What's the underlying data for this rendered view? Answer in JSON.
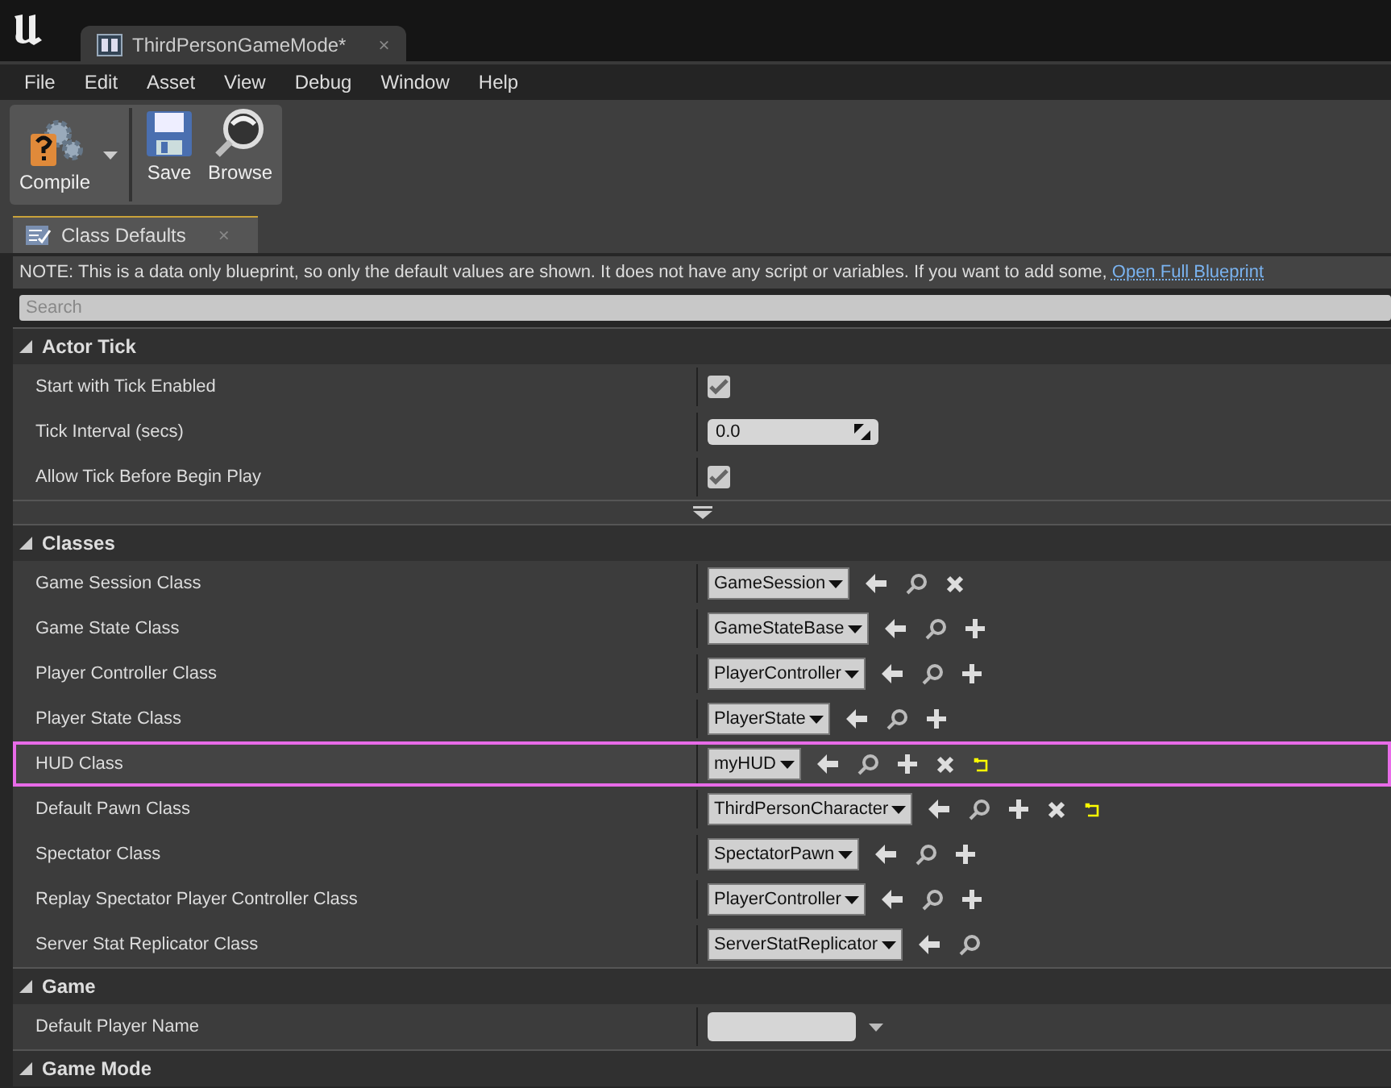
{
  "document_tab": {
    "title": "ThirdPersonGameMode*",
    "close": "×"
  },
  "menu": [
    "File",
    "Edit",
    "Asset",
    "View",
    "Debug",
    "Window",
    "Help"
  ],
  "toolbar": [
    {
      "kind": "compile",
      "label": "Compile"
    },
    {
      "kind": "save",
      "label": "Save"
    },
    {
      "kind": "browse",
      "label": "Browse"
    }
  ],
  "panel_tab": {
    "title": "Class Defaults",
    "close": "×"
  },
  "note": {
    "text": "NOTE: This is a data only blueprint, so only the default values are shown.  It does not have any script or variables.  If you want to add some,",
    "link": "Open Full Blueprint"
  },
  "search": {
    "placeholder": "Search"
  },
  "sections": [
    {
      "title": "Actor Tick",
      "expanded": true,
      "advanced": true,
      "rows": [
        {
          "label": "Start with Tick Enabled",
          "kind": "checkbox",
          "checked": true,
          "selected": false
        },
        {
          "label": "Tick Interval (secs)",
          "kind": "number",
          "value": "0.0",
          "selected": false
        },
        {
          "label": "Allow Tick Before Begin Play",
          "kind": "checkbox",
          "checked": true,
          "selected": false
        }
      ]
    },
    {
      "title": "Classes",
      "expanded": true,
      "rows": [
        {
          "label": "Game Session Class",
          "kind": "class",
          "value": "GameSession",
          "actions": [
            {
              "kind": "use"
            },
            {
              "kind": "browse"
            },
            {
              "kind": "clear"
            }
          ],
          "selected": false
        },
        {
          "label": "Game State Class",
          "kind": "class",
          "value": "GameStateBase",
          "actions": [
            {
              "kind": "use"
            },
            {
              "kind": "browse"
            },
            {
              "kind": "new"
            }
          ],
          "selected": false
        },
        {
          "label": "Player Controller Class",
          "kind": "class",
          "value": "PlayerController",
          "actions": [
            {
              "kind": "use"
            },
            {
              "kind": "browse"
            },
            {
              "kind": "new"
            }
          ],
          "selected": false
        },
        {
          "label": "Player State Class",
          "kind": "class",
          "value": "PlayerState",
          "actions": [
            {
              "kind": "use"
            },
            {
              "kind": "browse"
            },
            {
              "kind": "new"
            }
          ],
          "selected": false
        },
        {
          "label": "HUD Class",
          "kind": "class",
          "value": "myHUD",
          "actions": [
            {
              "kind": "use"
            },
            {
              "kind": "browse"
            },
            {
              "kind": "new"
            },
            {
              "kind": "clear"
            },
            {
              "kind": "reset"
            }
          ],
          "selected": true
        },
        {
          "label": "Default Pawn Class",
          "kind": "class",
          "value": "ThirdPersonCharacter",
          "actions": [
            {
              "kind": "use"
            },
            {
              "kind": "browse"
            },
            {
              "kind": "new"
            },
            {
              "kind": "clear"
            },
            {
              "kind": "reset"
            }
          ],
          "selected": false
        },
        {
          "label": "Spectator Class",
          "kind": "class",
          "value": "SpectatorPawn",
          "actions": [
            {
              "kind": "use"
            },
            {
              "kind": "browse"
            },
            {
              "kind": "new"
            }
          ],
          "selected": false
        },
        {
          "label": "Replay Spectator Player Controller Class",
          "kind": "class",
          "value": "PlayerController",
          "actions": [
            {
              "kind": "use"
            },
            {
              "kind": "browse"
            },
            {
              "kind": "new"
            }
          ],
          "selected": false
        },
        {
          "label": "Server Stat Replicator Class",
          "kind": "class",
          "value": "ServerStatReplicator",
          "actions": [
            {
              "kind": "use"
            },
            {
              "kind": "browse"
            }
          ],
          "selected": false
        }
      ]
    },
    {
      "title": "Game",
      "expanded": true,
      "rows": [
        {
          "label": "Default Player Name",
          "kind": "text_combo",
          "selected": false
        }
      ]
    },
    {
      "title": "Game Mode",
      "expanded": true
    }
  ]
}
